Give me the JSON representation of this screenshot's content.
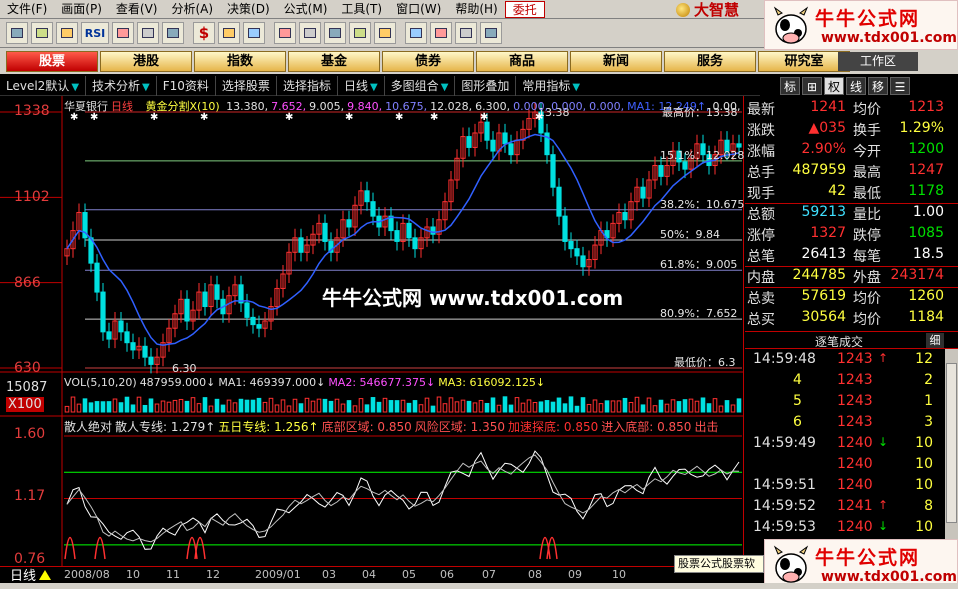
{
  "menu": {
    "items": [
      "文件(F)",
      "画面(P)",
      "查看(V)",
      "分析(A)",
      "决策(D)",
      "公式(M)",
      "工具(T)",
      "窗口(W)",
      "帮助(H)",
      "委托"
    ],
    "brand": "大智慧"
  },
  "toolbar": {
    "icons": [
      "open-icon",
      "layout-icon",
      "chart-icon",
      "rsi-icon",
      "grid-icon",
      "crosshair-icon",
      "ruler-icon",
      "dollar-icon",
      "finance-icon",
      "book-icon",
      "binoculars-icon",
      "alert-icon",
      "report-icon",
      "news-icon",
      "calendar-icon",
      "message-icon",
      "note-icon",
      "window-icon",
      "toolbox-icon"
    ],
    "rsi_label": "RSI",
    "dollar_label": "$"
  },
  "categories": [
    "股票",
    "港股",
    "指数",
    "基金",
    "债券",
    "商品",
    "新闻",
    "服务",
    "研究室"
  ],
  "workarea_label": "工作区",
  "funcbar": {
    "items": [
      "Level2默认",
      "技术分析",
      "F10资料",
      "选择股票",
      "选择指标",
      "日线",
      "多图组合",
      "图形叠加",
      "常用指标"
    ]
  },
  "sidetabs": [
    "标",
    "⊞",
    "权",
    "线",
    "移",
    "☰"
  ],
  "chart": {
    "title_stock": "华夏银行",
    "title_period": "日线",
    "indicator_name": "黄金分割X(10)",
    "indicator_values": [
      "13.380",
      "7.652",
      "9.005",
      "9.840",
      "10.675",
      "12.028",
      "6.300",
      "0.000",
      "0.000",
      "0.000",
      "MA1: 12.249↑",
      "0.00"
    ],
    "price_axis": [
      "1338",
      "1102",
      "866",
      "630"
    ],
    "fib_levels": [
      "最高价：13.38",
      "15.1%：12.028",
      "38.2%：10.675",
      "50%：9.84",
      "61.8%：9.005",
      "80.9%：7.652",
      "最低价：6.3"
    ],
    "peak_label": "13.38",
    "low_label": "6.30",
    "vol_axis": [
      "15087",
      "X100"
    ],
    "vol_legend": [
      "VOL(5,10,20)",
      "487959.000↓",
      "MA1: 469397.000↓",
      "MA2: 546677.375↓",
      "MA3: 616092.125↓"
    ],
    "ind_axis": [
      "1.60",
      "1.17",
      "0.76"
    ],
    "ind_legend": [
      "散人绝对",
      "散人专线: 1.279↑",
      "五日专线: 1.256↑",
      "底部区域: 0.850",
      "风险区域: 1.350",
      "加速探底: 0.850",
      "进入底部: 0.850",
      "出击"
    ],
    "timeline": [
      "2008/08",
      "10",
      "11",
      "12",
      "2009/01",
      "03",
      "04",
      "05",
      "06",
      "07",
      "08",
      "09",
      "10"
    ],
    "period_badge": "日线",
    "watermark": "牛牛公式网 www.tdx001.com",
    "candles_close": [
      9.6,
      10.1,
      10.6,
      9.9,
      9.2,
      8.4,
      7.3,
      7.1,
      7.6,
      7.3,
      7.0,
      6.8,
      6.9,
      6.6,
      6.4,
      6.6,
      7.0,
      7.4,
      7.8,
      8.2,
      7.6,
      7.9,
      8.4,
      8.0,
      8.6,
      8.2,
      7.8,
      8.3,
      8.6,
      8.1,
      7.7,
      7.5,
      7.4,
      7.6,
      8.0,
      8.5,
      8.9,
      9.5,
      9.9,
      9.5,
      9.7,
      10.0,
      10.3,
      9.8,
      9.5,
      9.9,
      10.4,
      10.2,
      10.8,
      11.2,
      10.9,
      10.5,
      10.2,
      10.5,
      10.1,
      9.8,
      10.3,
      9.9,
      9.6,
      9.9,
      10.2,
      10.0,
      10.4,
      10.9,
      11.5,
      12.1,
      12.7,
      12.4,
      12.8,
      13.1,
      12.6,
      12.3,
      12.8,
      12.5,
      12.2,
      12.6,
      12.9,
      13.2,
      13.38,
      12.8,
      12.2,
      11.3,
      10.5,
      9.8,
      9.6,
      9.4,
      9.1,
      9.3,
      9.7,
      10.1,
      9.9,
      10.3,
      10.6,
      10.4,
      10.9,
      11.3,
      11.0,
      11.5,
      11.9,
      11.6,
      11.9,
      12.3,
      12.0,
      11.8,
      12.1,
      12.5,
      12.2,
      11.9,
      12.2,
      12.6,
      12.3,
      12.5,
      12.41
    ]
  },
  "quote": {
    "rows": [
      {
        "l1": "最新",
        "v1": "1241",
        "c1": "red",
        "l2": "均价",
        "v2": "1213",
        "c2": "red"
      },
      {
        "l1": "涨跌",
        "v1": "▲035",
        "c1": "red",
        "l2": "换手",
        "v2": "1.29%",
        "c2": "yel"
      },
      {
        "l1": "涨幅",
        "v1": "2.90%",
        "c1": "red",
        "l2": "今开",
        "v2": "1200",
        "c2": "grn"
      },
      {
        "l1": "总手",
        "v1": "487959",
        "c1": "yel",
        "l2": "最高",
        "v2": "1247",
        "c2": "red"
      },
      {
        "l1": "现手",
        "v1": "42",
        "c1": "yel",
        "l2": "最低",
        "v2": "1178",
        "c2": "grn"
      },
      {
        "l1": "总额",
        "v1": "59213",
        "c1": "cyn",
        "l2": "量比",
        "v2": "1.00",
        "c2": "wht"
      },
      {
        "l1": "涨停",
        "v1": "1327",
        "c1": "red",
        "l2": "跌停",
        "v2": "1085",
        "c2": "grn"
      },
      {
        "l1": "总笔",
        "v1": "26413",
        "c1": "wht",
        "l2": "每笔",
        "v2": "18.5",
        "c2": "wht"
      },
      {
        "l1": "内盘",
        "v1": "244785",
        "c1": "yel",
        "l2": "外盘",
        "v2": "243174",
        "c2": "red"
      },
      {
        "l1": "总卖",
        "v1": "57619",
        "c1": "yel",
        "l2": "均价",
        "v2": "1260",
        "c2": "yel"
      },
      {
        "l1": "总买",
        "v1": "30564",
        "c1": "yel",
        "l2": "均价",
        "v2": "1184",
        "c2": "yel"
      }
    ]
  },
  "ticks": {
    "header": "逐笔成交",
    "button": "细",
    "rows": [
      {
        "time": "14:59:48",
        "price": "1243",
        "arrow": "↑",
        "vol": "12",
        "pc": "red",
        "vc": "yel"
      },
      {
        "time": "",
        "price": "1243",
        "arrow": "",
        "vol": "2",
        "pc": "red",
        "vc": "yel"
      },
      {
        "time": "",
        "price": "1243",
        "arrow": "",
        "vol": "1",
        "pc": "red",
        "vc": "yel"
      },
      {
        "time": "",
        "price": "1243",
        "arrow": "",
        "vol": "3",
        "pc": "red",
        "vc": "yel"
      },
      {
        "time": "14:59:49",
        "price": "1240",
        "arrow": "↓",
        "vol": "10",
        "pc": "red",
        "vc": "yel"
      },
      {
        "time": "",
        "price": "1240",
        "arrow": "",
        "vol": "10",
        "pc": "red",
        "vc": "yel"
      },
      {
        "time": "14:59:51",
        "price": "1240",
        "arrow": "",
        "vol": "10",
        "pc": "red",
        "vc": "yel"
      },
      {
        "time": "14:59:52",
        "price": "1241",
        "arrow": "↑",
        "vol": "8",
        "pc": "red",
        "vc": "yel"
      },
      {
        "time": "14:59:53",
        "price": "1240",
        "arrow": "↓",
        "vol": "10",
        "pc": "red",
        "vc": "yel"
      }
    ],
    "min_rows": [
      4,
      5,
      6
    ],
    "first_vols": [
      "4",
      "5",
      "6"
    ]
  },
  "logo": {
    "title": "牛牛公式网",
    "url": "www.tdx001.com"
  },
  "status_strip": "股票公式股票软",
  "colors": {
    "up": "#ff3030",
    "down": "#00e0e0",
    "ma_blue": "#3060ff",
    "fib_line": "#a0a0a0",
    "accent_red": "#c00000"
  }
}
